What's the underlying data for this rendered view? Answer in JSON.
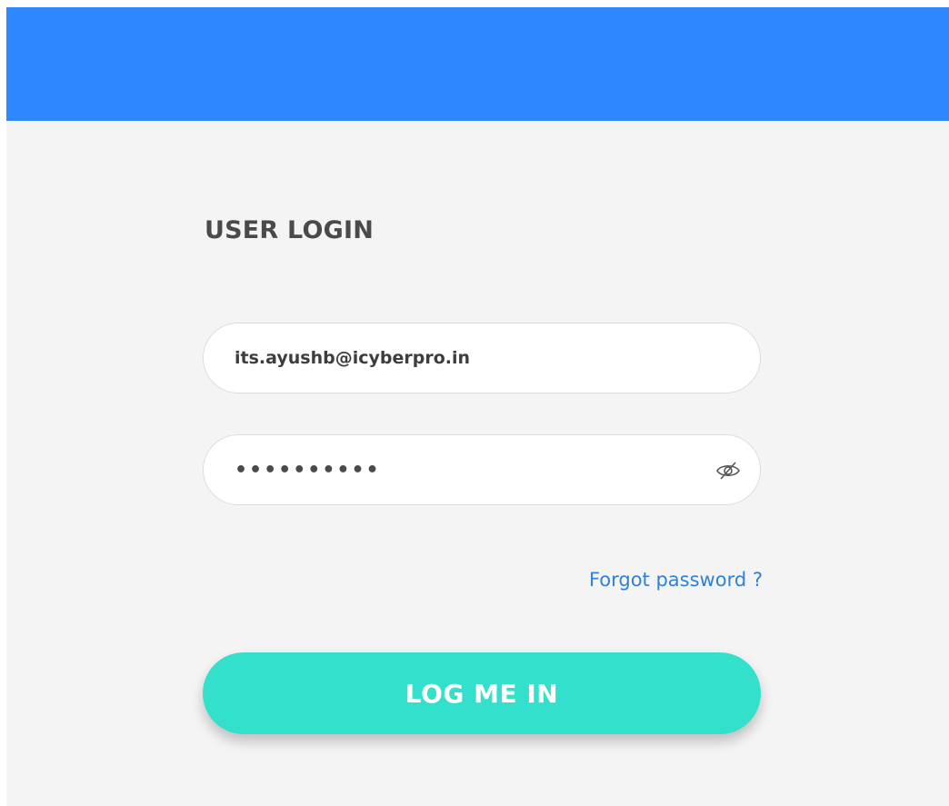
{
  "header": {
    "bar_color": "#2f88ff"
  },
  "login": {
    "title": "USER LOGIN",
    "email": {
      "value": "its.ayushb@icyberpro.in",
      "icon": null
    },
    "password": {
      "masked_value": "••••••••••",
      "toggle_icon": "eye-slash-icon"
    },
    "forgot_password_label": "Forgot password ?",
    "submit_label": "LOG ME IN"
  },
  "colors": {
    "background": "#f4f4f4",
    "accent_button": "#33e0cb",
    "link": "#2f82d8",
    "title_text": "#4a4a4a"
  }
}
